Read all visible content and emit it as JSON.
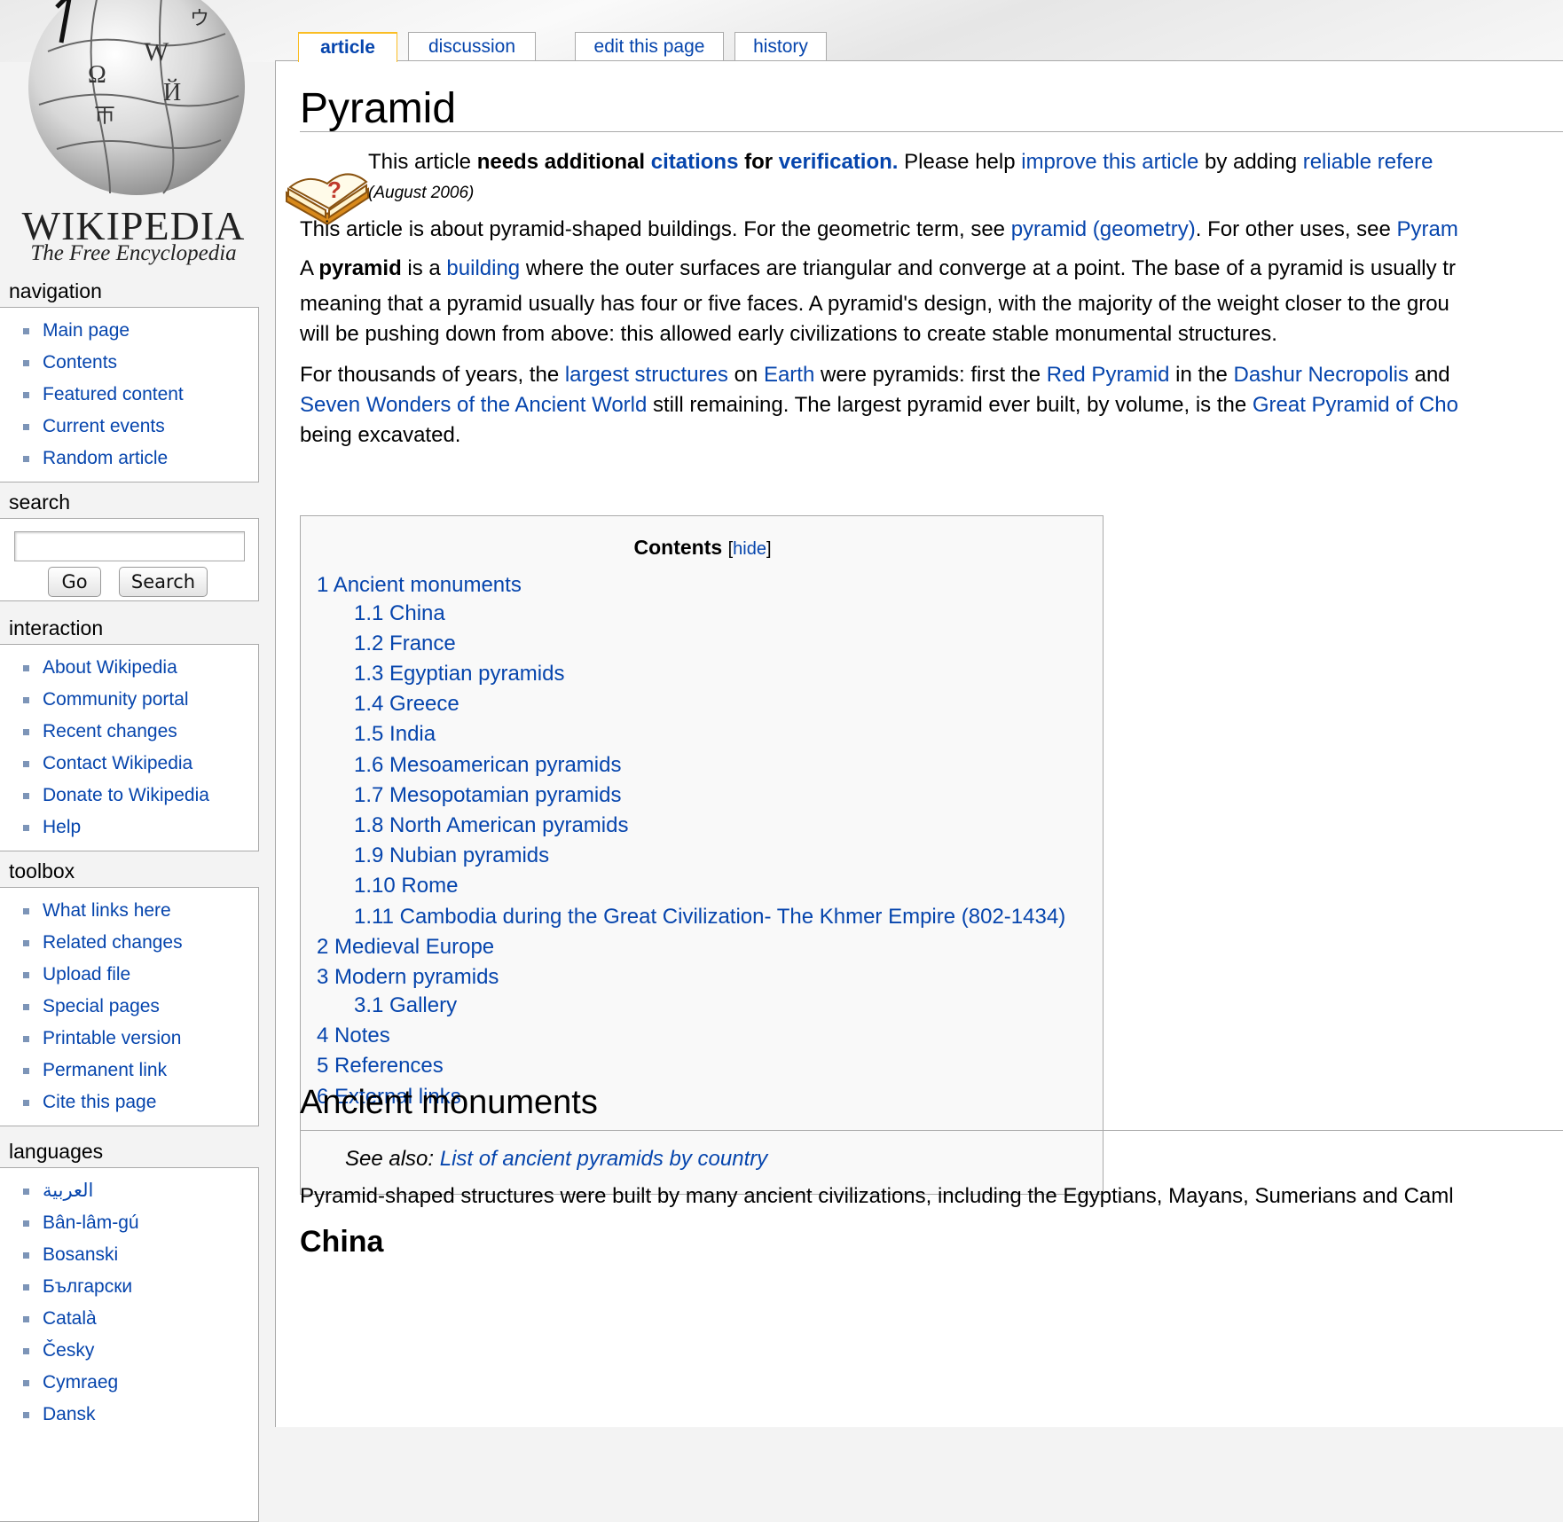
{
  "logo": {
    "wordmark": "WIKIPEDIA",
    "tagline": "The Free Encyclopedia"
  },
  "tabs": [
    {
      "label": "article",
      "selected": true
    },
    {
      "label": "discussion",
      "selected": false
    },
    {
      "label": "edit this page",
      "selected": false
    },
    {
      "label": "history",
      "selected": false
    }
  ],
  "sidebar": {
    "navigation": {
      "title": "navigation",
      "items": [
        "Main page",
        "Contents",
        "Featured content",
        "Current events",
        "Random article"
      ]
    },
    "search": {
      "title": "search",
      "go_label": "Go",
      "search_label": "Search",
      "query": ""
    },
    "interaction": {
      "title": "interaction",
      "items": [
        "About Wikipedia",
        "Community portal",
        "Recent changes",
        "Contact Wikipedia",
        "Donate to Wikipedia",
        "Help"
      ]
    },
    "toolbox": {
      "title": "toolbox",
      "items": [
        "What links here",
        "Related changes",
        "Upload file",
        "Special pages",
        "Printable version",
        "Permanent link",
        "Cite this page"
      ]
    },
    "languages": {
      "title": "languages",
      "items": [
        "العربية",
        "Bân-lâm-gú",
        "Bosanski",
        "Български",
        "Català",
        "Česky",
        "Cymraeg",
        "Dansk"
      ]
    }
  },
  "article": {
    "title": "Pyramid",
    "notice": {
      "t1": "This article ",
      "t2": "needs additional ",
      "t3": "citations",
      "t4": " for ",
      "t5": "verification.",
      "t6": " Please help ",
      "t7": "improve this article",
      "t8": " by adding ",
      "t9": "reliable refere",
      "date": "(August 2006)"
    },
    "hatnote": {
      "t1": "This article is about pyramid-shaped buildings. For the geometric term, see ",
      "link1": "pyramid (geometry)",
      "t2": ". For other uses, see ",
      "link2": "Pyram"
    },
    "para1": {
      "t1": "A ",
      "bold": "pyramid",
      "t2": " is a ",
      "link1": "building",
      "t3": " where the outer surfaces are triangular and converge at a point. The base of a pyramid is usually tr",
      "line2": "meaning that a pyramid usually has four or five faces. A pyramid's design, with the majority of the weight closer to the grou",
      "line3": "will be pushing down from above: this allowed early civilizations to create stable monumental structures."
    },
    "para2": {
      "t1": "For thousands of years, the ",
      "link1": "largest structures",
      "t2": " on ",
      "link2": "Earth",
      "t3": " were pyramids: first the ",
      "link3": "Red Pyramid",
      "t4": " in the ",
      "link4": "Dashur Necropolis",
      "t5": " and",
      "link5": "Seven Wonders of the Ancient World",
      "t6": " still remaining. The largest pyramid ever built, by volume, is the ",
      "link6": "Great Pyramid of Cho",
      "line3": "being excavated."
    },
    "toc": {
      "title": "Contents",
      "bracket_open": "[",
      "hide_label": "hide",
      "bracket_close": "]",
      "items": [
        {
          "num": "1",
          "label": "Ancient monuments",
          "level": 1
        },
        {
          "num": "1.1",
          "label": "China",
          "level": 2
        },
        {
          "num": "1.2",
          "label": "France",
          "level": 2
        },
        {
          "num": "1.3",
          "label": "Egyptian pyramids",
          "level": 2
        },
        {
          "num": "1.4",
          "label": "Greece",
          "level": 2
        },
        {
          "num": "1.5",
          "label": "India",
          "level": 2
        },
        {
          "num": "1.6",
          "label": "Mesoamerican pyramids",
          "level": 2
        },
        {
          "num": "1.7",
          "label": "Mesopotamian pyramids",
          "level": 2
        },
        {
          "num": "1.8",
          "label": "North American pyramids",
          "level": 2
        },
        {
          "num": "1.9",
          "label": "Nubian pyramids",
          "level": 2
        },
        {
          "num": "1.10",
          "label": "Rome",
          "level": 2
        },
        {
          "num": "1.11",
          "label": "Cambodia during the Great Civilization- The Khmer Empire (802-1434)",
          "level": 2
        },
        {
          "num": "2",
          "label": "Medieval Europe",
          "level": 1
        },
        {
          "num": "3",
          "label": "Modern pyramids",
          "level": 1
        },
        {
          "num": "3.1",
          "label": "Gallery",
          "level": 2
        },
        {
          "num": "4",
          "label": "Notes",
          "level": 1
        },
        {
          "num": "5",
          "label": "References",
          "level": 1
        },
        {
          "num": "6",
          "label": "External links",
          "level": 1
        }
      ]
    },
    "section1": {
      "heading": "Ancient monuments",
      "see_also_label": "See also: ",
      "see_also_link": "List of ancient pyramids by country",
      "text": "Pyramid-shaped structures were built by many ancient civilizations, including the Egyptians, Mayans, Sumerians and Caml"
    },
    "section2": {
      "heading": "China"
    }
  }
}
